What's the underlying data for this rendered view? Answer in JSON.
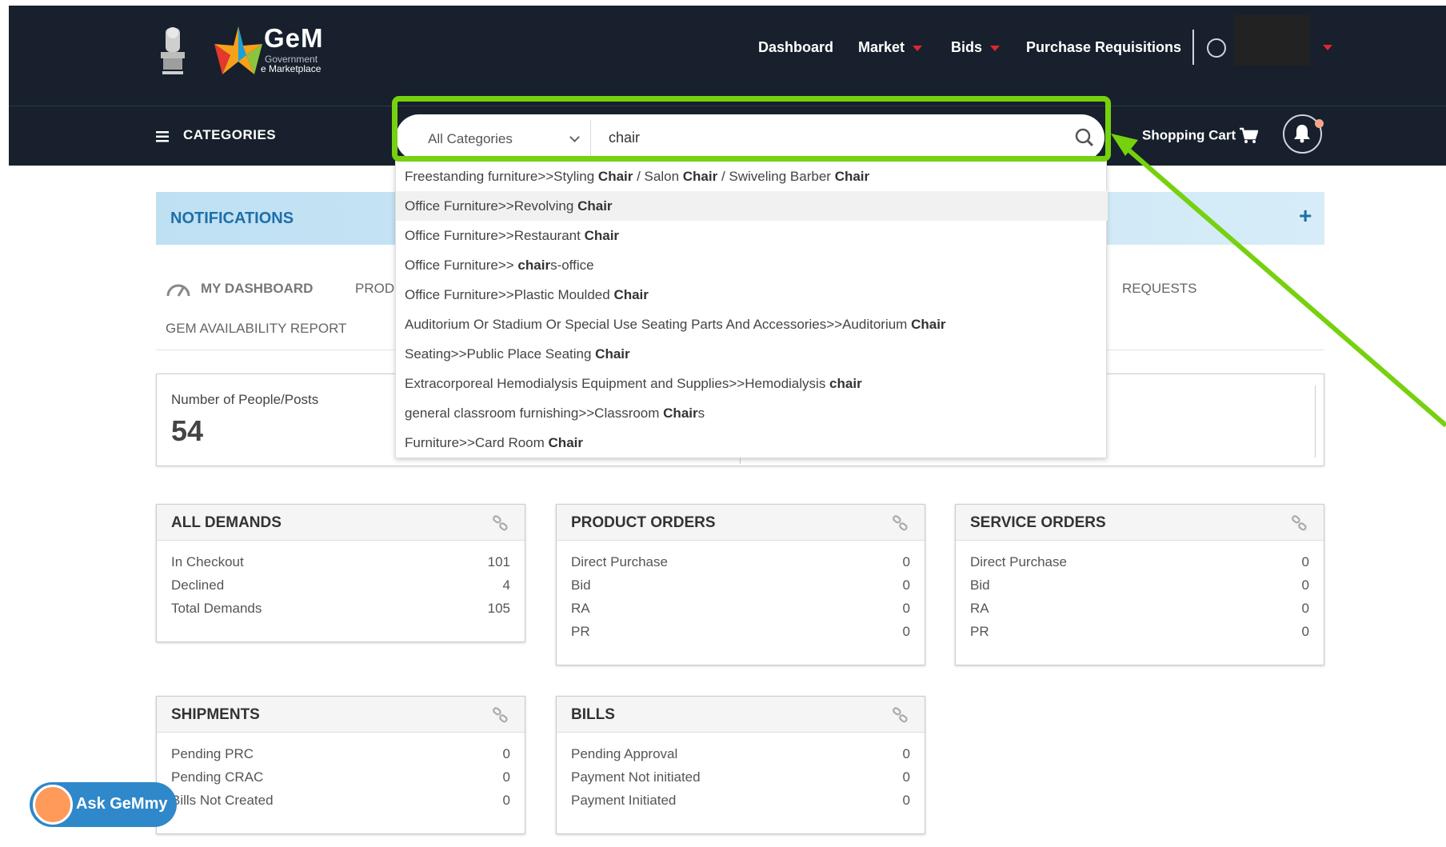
{
  "header": {
    "logo_title": "GeM",
    "logo_sub1": "Government",
    "logo_sub2": "e Marketplace",
    "nav": {
      "dashboard": "Dashboard",
      "market": "Market",
      "bids": "Bids",
      "purchase_requisitions": "Purchase Requisitions"
    },
    "categories_label": "CATEGORIES",
    "cart_label": "Shopping Cart"
  },
  "search": {
    "category": "All Categories",
    "query": "chair",
    "suggestions": [
      {
        "prefix": "Freestanding furniture>>Styling ",
        "bold": "Chair",
        "suffix": " / Salon ",
        "bold2": "Chair",
        "suffix2": " / Swiveling Barber ",
        "bold3": "Chair"
      },
      {
        "prefix": "Office Furniture>>Revolving ",
        "bold": "Chair",
        "suffix": ""
      },
      {
        "prefix": "Office Furniture>>Restaurant ",
        "bold": "Chair",
        "suffix": ""
      },
      {
        "prefix": "Office Furniture>> ",
        "bold": "chair",
        "suffix": "s-office"
      },
      {
        "prefix": "Office Furniture>>Plastic Moulded ",
        "bold": "Chair",
        "suffix": ""
      },
      {
        "prefix": "Auditorium Or Stadium Or Special Use Seating Parts And Accessories>>Auditorium ",
        "bold": "Chair",
        "suffix": ""
      },
      {
        "prefix": "Seating>>Public Place Seating ",
        "bold": "Chair",
        "suffix": ""
      },
      {
        "prefix": "Extracorporeal Hemodialysis Equipment and Supplies>>Hemodialysis ",
        "bold": "chair",
        "suffix": ""
      },
      {
        "prefix": "general classroom furnishing>>Classroom ",
        "bold": "Chair",
        "suffix": "s"
      },
      {
        "prefix": "Furniture>>Card Room ",
        "bold": "Chair",
        "suffix": ""
      }
    ]
  },
  "notifications": {
    "title": "NOTIFICATIONS",
    "expand": "+"
  },
  "tabs": {
    "my_dashboard": "MY DASHBOARD",
    "products": "PROD",
    "requests": "REQUESTS",
    "gem_availability": "GEM AVAILABILITY REPORT"
  },
  "summary": {
    "label": "Number of People/Posts",
    "value": "54"
  },
  "cards": {
    "all_demands": {
      "title": "ALL DEMANDS",
      "rows": [
        [
          "In Checkout",
          "101"
        ],
        [
          "Declined",
          "4"
        ],
        [
          "Total Demands",
          "105"
        ]
      ]
    },
    "product_orders": {
      "title": "PRODUCT ORDERS",
      "rows": [
        [
          "Direct Purchase",
          "0"
        ],
        [
          "Bid",
          "0"
        ],
        [
          "RA",
          "0"
        ],
        [
          "PR",
          "0"
        ]
      ]
    },
    "service_orders": {
      "title": "SERVICE ORDERS",
      "rows": [
        [
          "Direct Purchase",
          "0"
        ],
        [
          "Bid",
          "0"
        ],
        [
          "RA",
          "0"
        ],
        [
          "PR",
          "0"
        ]
      ]
    },
    "shipments": {
      "title": "SHIPMENTS",
      "rows": [
        [
          "Pending PRC",
          "0"
        ],
        [
          "Pending CRAC",
          "0"
        ],
        [
          "Bills Not Created",
          "0"
        ]
      ]
    },
    "bills": {
      "title": "BILLS",
      "rows": [
        [
          "Pending Approval",
          "0"
        ],
        [
          "Payment Not initiated",
          "0"
        ],
        [
          "Payment Initiated",
          "0"
        ]
      ]
    }
  },
  "assistant": {
    "label": "Ask GeMmy"
  },
  "colors": {
    "header_bg": "#17202c",
    "highlight": "#76d10e",
    "notif_text": "#1f6fa8",
    "caret": "#e0262e"
  }
}
